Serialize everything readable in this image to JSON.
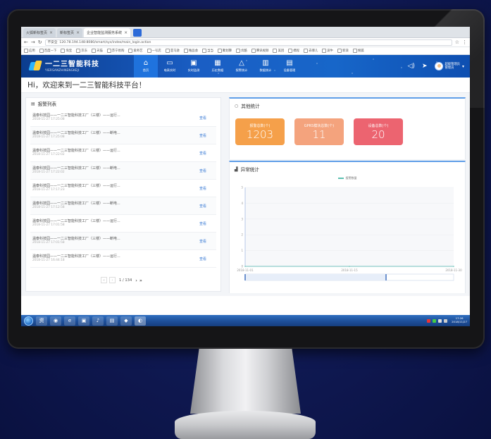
{
  "browser": {
    "tabs": [
      {
        "label": "火狐新标签页",
        "active": false
      },
      {
        "label": "新标签页",
        "active": false
      },
      {
        "label": "企业智能监测服务系统",
        "active": true
      }
    ],
    "url": "120.78.194.148:8080/smart/sys/index/main_login.action",
    "url_prefix": "不安全",
    "bookmarks": [
      "应用",
      "百度一下",
      "淘宝",
      "京东",
      "天猫",
      "苏宁易购",
      "爱奇艺",
      "一号店",
      "亚马逊",
      "唯品会",
      "当当",
      "聚划算",
      "优酷",
      "腾讯视频",
      "美团",
      "携程",
      "去哪儿",
      "途牛",
      "新浪",
      "搜狐"
    ]
  },
  "header": {
    "logo_cn": "一二三智能科技",
    "logo_en": "YIERSANZHINENGKEJI",
    "nav": [
      {
        "icon": "⌂",
        "label": "首页",
        "active": true
      },
      {
        "icon": "▭",
        "label": "电表实时",
        "active": false
      },
      {
        "icon": "▣",
        "label": "实时监测",
        "active": false
      },
      {
        "icon": "▦",
        "label": "历史数据",
        "active": false
      },
      {
        "icon": "△",
        "label": "报警统计",
        "active": false
      },
      {
        "icon": "▥",
        "label": "数据统计",
        "active": false
      },
      {
        "icon": "▤",
        "label": "设备管理",
        "active": false
      }
    ],
    "user_name": "超级管理员",
    "user_role": "管理员"
  },
  "welcome": "Hi，欢迎来到一二三智能科技平台！",
  "alarms": {
    "title": "报警列表",
    "link_label": "查看",
    "items": [
      {
        "title": "温泰科技园——一二三智能科技工厂（三楼）——运行...",
        "time": "2018-11-27 17:25:08"
      },
      {
        "title": "温泰科技园——一二三智能科技工厂（三楼）——断电...",
        "time": "2018-11-27 17:25:08"
      },
      {
        "title": "温泰科技园——一二三智能科技工厂（三楼）——运行...",
        "time": "2018-11-27 17:22:02"
      },
      {
        "title": "温泰科技园——一二三智能科技工厂（三楼）——断电...",
        "time": "2018-11-27 17:22:02"
      },
      {
        "title": "温泰科技园——一二三智能科技工厂（三楼）——运行...",
        "time": "2018-11-27 17:17:23"
      },
      {
        "title": "温泰科技园——一二三智能科技工厂（三楼）——断电...",
        "time": "2018-11-27 17:12:58"
      },
      {
        "title": "温泰科技园——一二三智能科技工厂（三楼）——运行...",
        "time": "2018-11-27 17:01:58"
      },
      {
        "title": "温泰科技园——一二三智能科技工厂（三楼）——断电...",
        "time": "2018-11-27 17:01:58"
      },
      {
        "title": "温泰科技园——一二三智能科技工厂（三楼）——运行...",
        "time": "2018-11-27 16:44:18"
      }
    ],
    "pager": {
      "info": "1 / 134",
      "prev": "‹",
      "first": "«",
      "next": "›",
      "last": "»"
    }
  },
  "other_stats": {
    "title": "其他统计",
    "cards": [
      {
        "label": "报警总数(个)",
        "value": "1203",
        "color": "#f5a04a"
      },
      {
        "label": "GPRS模块总数(个)",
        "value": "11",
        "color": "#f4a37d"
      },
      {
        "label": "设备总数(个)",
        "value": "20",
        "color": "#ec6470"
      }
    ]
  },
  "anomaly": {
    "title": "异常统计",
    "legend": "报警数量",
    "legend_color": "#5cc0b0"
  },
  "chart_data": {
    "type": "line",
    "series": [
      {
        "name": "报警数量",
        "values": [
          0,
          0,
          0
        ]
      }
    ],
    "x": [
      "2018-11-01",
      "2018-11-15",
      "2018-11-30"
    ],
    "yticks": [
      "0",
      "1",
      "2",
      "3",
      "4",
      "5"
    ],
    "ylim": [
      0,
      5
    ],
    "grid": true
  },
  "taskbar": {
    "apps": [
      "资",
      "◉",
      "e",
      "▣",
      "♪",
      "▤",
      "◆",
      "◐"
    ],
    "time": "17:26",
    "date": "2018/11/27"
  }
}
